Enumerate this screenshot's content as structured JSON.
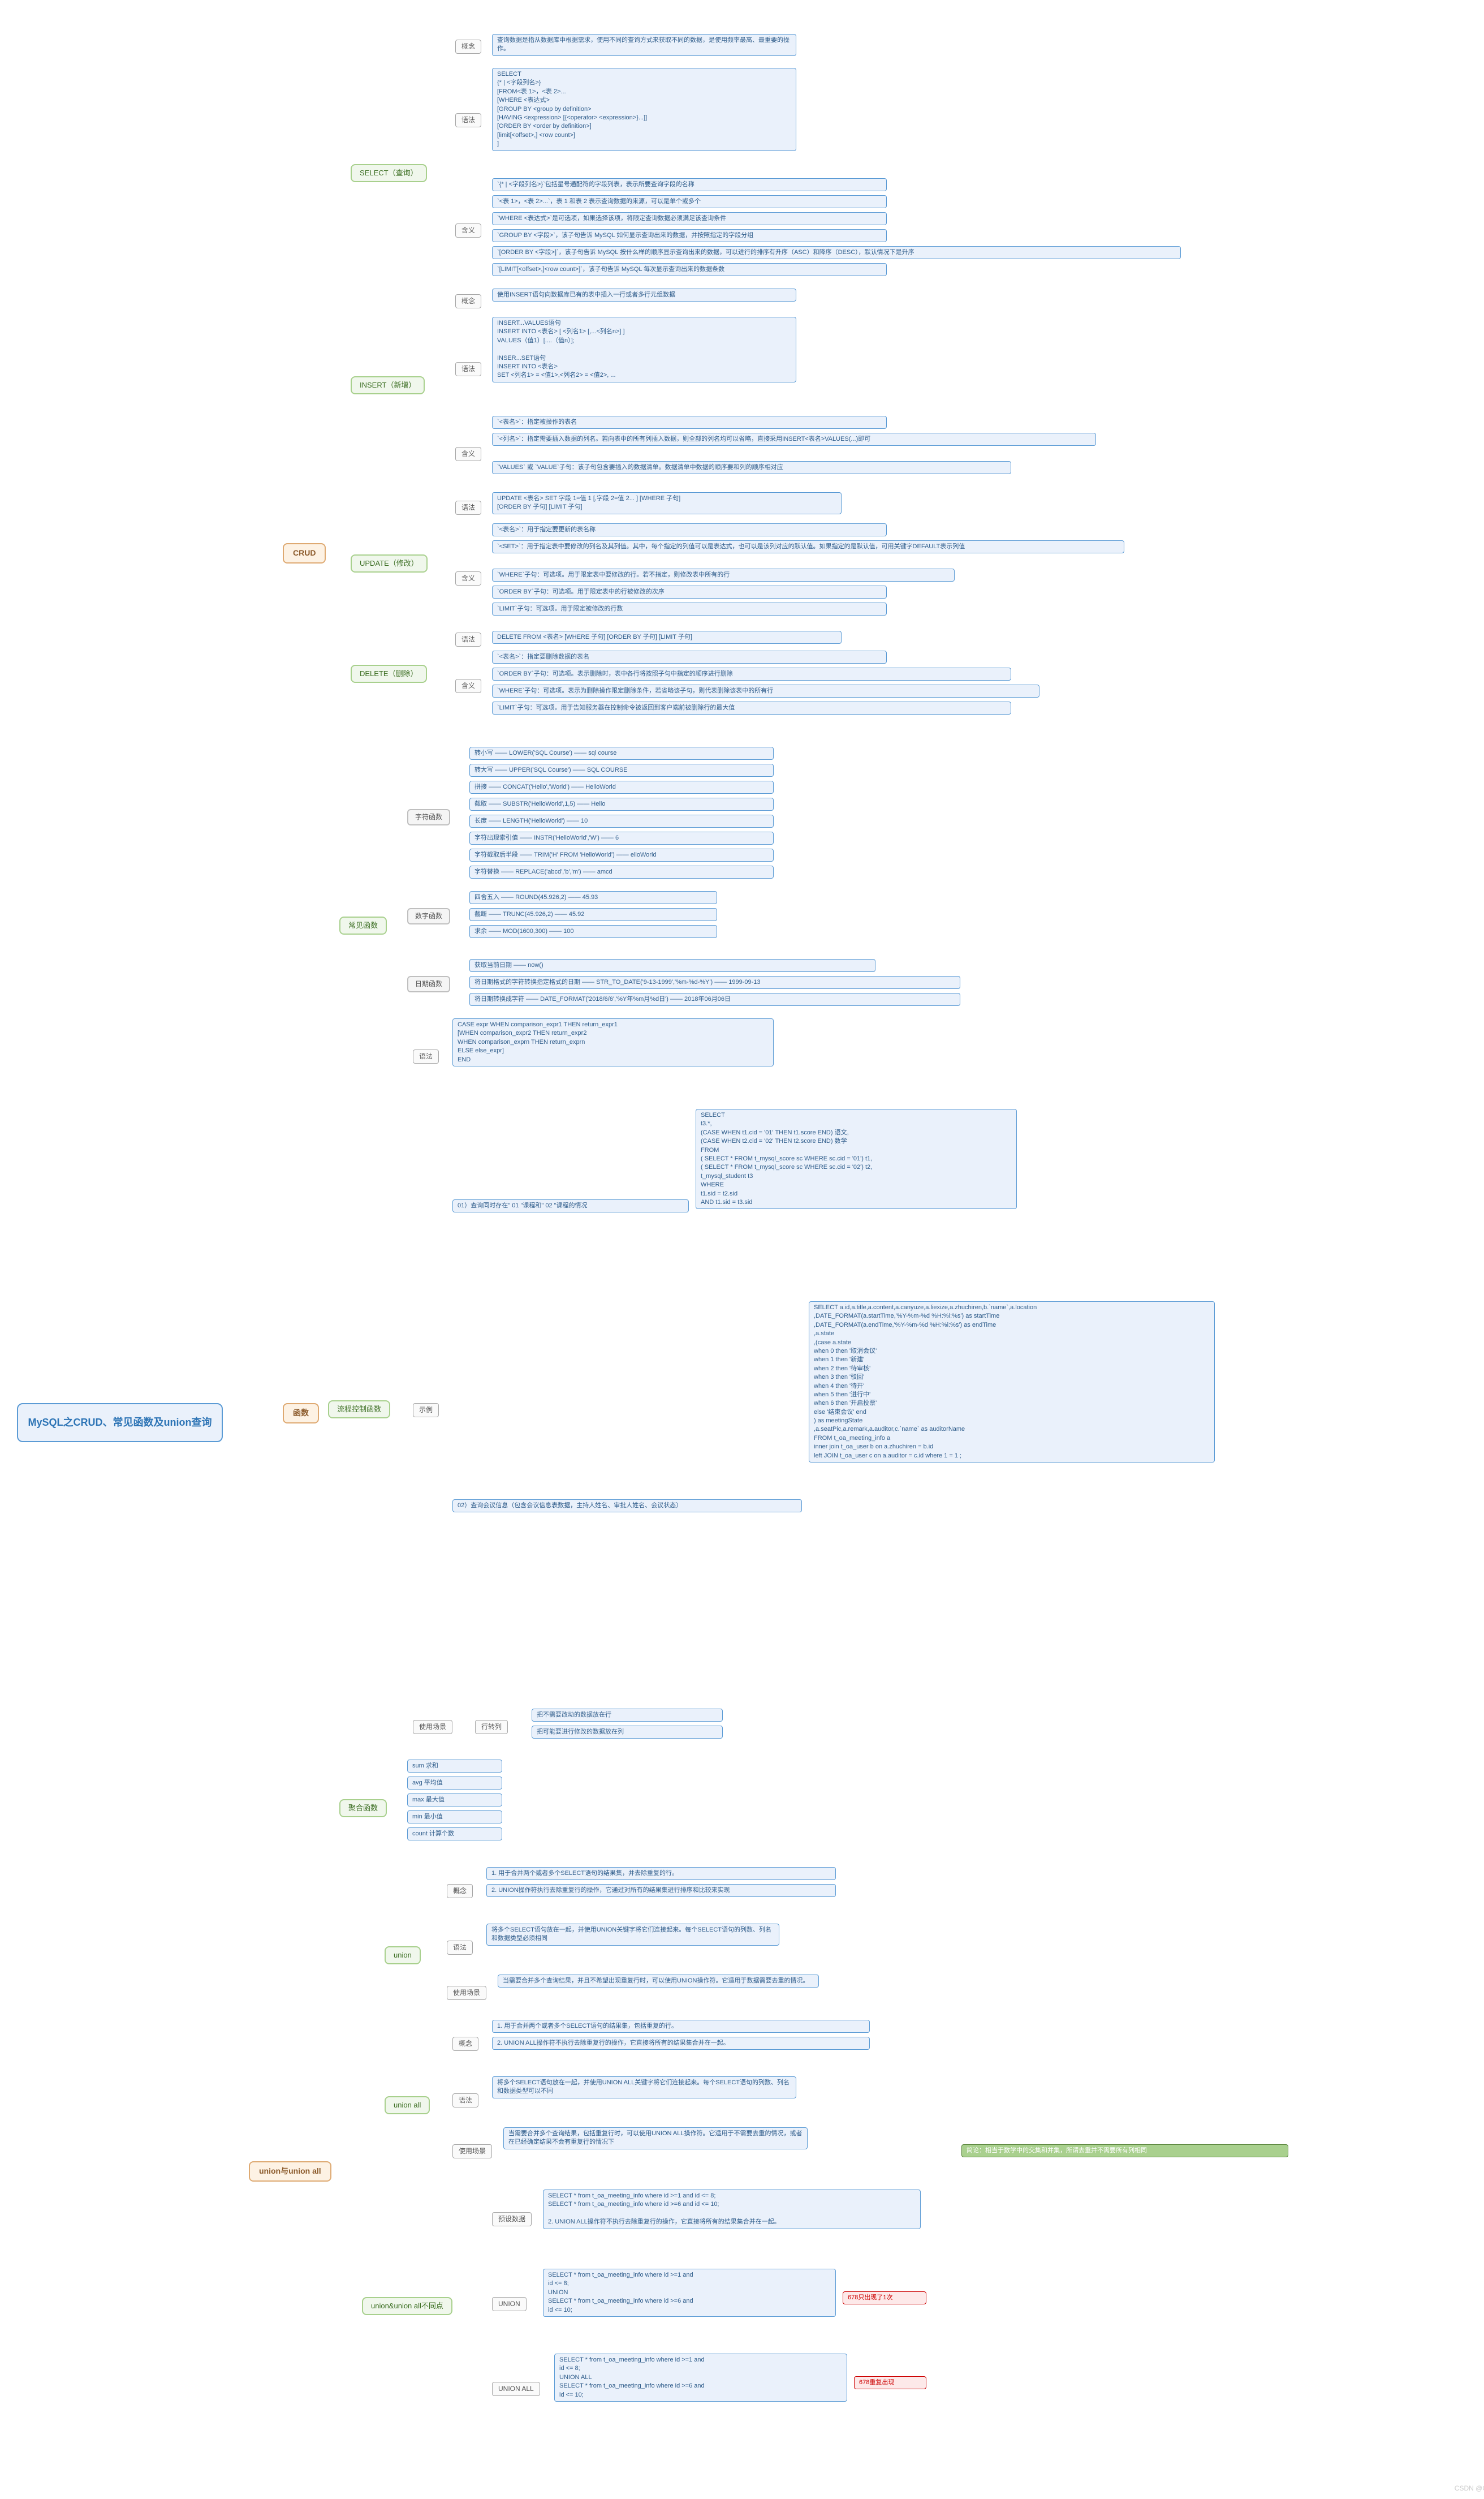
{
  "root": "MySQL之CRUD、常见函数及union查询",
  "crud": {
    "label": "CRUD",
    "select": {
      "label": "SELECT（查询）",
      "gainian": {
        "k": "概念",
        "v": "查询数据是指从数据库中根据需求，使用不同的查询方式来获取不同的数据，是使用频率最高、最重要的操作。"
      },
      "yufa": {
        "k": "语法",
        "v": "SELECT\n{* | <字段列名>}\n[FROM<表 1>，<表 2>...\n[WHERE <表达式>\n[GROUP BY <group by definition>\n[HAVING <expression> [{<operator> <expression>}...]]\n[ORDER BY <order by definition>]\n[limit[<offset>,] <row count>]\n]"
      },
      "hanyi": {
        "k": "含义",
        "items": [
          "`{* | <字段列名>}`包括星号通配符的字段列表，表示所要查询字段的名称",
          "`<表 1>，<表 2>...`，表 1 和表 2 表示查询数据的来源，可以是单个或多个",
          "`WHERE <表达式>`是可选项，如果选择该项，将限定查询数据必须满足该查询条件",
          "`GROUP BY <字段>`，该子句告诉 MySQL 如何显示查询出来的数据，并按照指定的字段分组",
          "`[ORDER BY <字段>]`，该子句告诉 MySQL 按什么样的顺序显示查询出来的数据，可以进行的排序有升序（ASC）和降序（DESC），默认情况下是升序",
          "`[LIMIT[<offset>,]<row count>]`，该子句告诉 MySQL 每次显示查询出来的数据条数"
        ]
      }
    },
    "insert": {
      "label": "INSERT（新增）",
      "gainian": {
        "k": "概念",
        "v": "使用INSERT语句向数据库已有的表中插入一行或者多行元组数据"
      },
      "yufa": {
        "k": "语法",
        "v": "INSERT...VALUES语句\nINSERT INTO <表名> [ <列名1> [,...<列名n>] ]\nVALUES（值1）[....（值n）];\n\nINSER...SET语句\nINSERT INTO <表名>\nSET <列名1> = <值1>,<列名2> = <值2>, ..."
      },
      "hanyi": {
        "k": "含义",
        "items": [
          "`<表名>`：指定被操作的表名",
          "`<列名>`：指定需要插入数据的列名。若向表中的所有列插入数据，则全部的列名均可以省略，直接采用INSERT<表名>VALUES(...)即可",
          "`VALUES` 或 `VALUE`子句：该子句包含要插入的数据清单。数据清单中数据的顺序要和列的顺序相对应"
        ]
      }
    },
    "update": {
      "label": "UPDATE（修改）",
      "yufa": {
        "k": "语法",
        "v": "UPDATE <表名> SET 字段 1=值 1 [,字段 2=值 2... ] [WHERE 子句]\n[ORDER BY 子句] [LIMIT 子句]"
      },
      "hanyi": {
        "k": "含义",
        "items": [
          "`<表名>`：用于指定要更新的表名称",
          "`<SET>`：用于指定表中要修改的列名及其列值。其中，每个指定的列值可以是表达式，也可以是该列对应的默认值。如果指定的是默认值，可用关键字DEFAULT表示列值",
          "`WHERE`子句：可选项。用于限定表中要修改的行。若不指定，则修改表中所有的行",
          "`ORDER BY`子句：可选项。用于限定表中的行被修改的次序",
          "`LIMIT`子句：可选项。用于限定被修改的行数"
        ]
      }
    },
    "delete": {
      "label": "DELETE（删除）",
      "yufa": {
        "k": "语法",
        "v": "DELETE FROM <表名> [WHERE 子句] [ORDER BY 子句] [LIMIT 子句]"
      },
      "hanyi": {
        "k": "含义",
        "items": [
          "`<表名>`：指定要删除数据的表名",
          "`ORDER BY`子句：可选项。表示删除时，表中各行将按照子句中指定的顺序进行删除",
          "`WHERE`子句：可选项。表示为删除操作限定删除条件，若省略该子句，则代表删除该表中的所有行",
          "`LIMIT`子句：可选项。用于告知服务器在控制命令被返回到客户端前被删除行的最大值"
        ]
      }
    }
  },
  "hanshu": {
    "label": "函数",
    "changjian": {
      "label": "常见函数",
      "zifu": {
        "label": "字符函数",
        "items": [
          "转小写 —— LOWER('SQL Course') —— sql course",
          "转大写 —— UPPER('SQL Course') —— SQL COURSE",
          "拼接 —— CONCAT('Hello','World') —— HelloWorld",
          "截取 —— SUBSTR('HelloWorld',1,5) —— Hello",
          "长度 —— LENGTH('HelloWorld') —— 10",
          "字符出现索引值 —— INSTR('HelloWorld','W') —— 6",
          "字符截取后半段 —— TRIM('H' FROM 'HelloWorld') —— elloWorld",
          "字符替换 —— REPLACE('abcd','b','m') —— amcd"
        ]
      },
      "shuzi": {
        "label": "数字函数",
        "items": [
          "四舍五入 —— ROUND(45.926,2) —— 45.93",
          "截断 —— TRUNC(45.926,2) —— 45.92",
          "求余 —— MOD(1600,300) —— 100"
        ]
      },
      "riqi": {
        "label": "日期函数",
        "items": [
          "获取当前日期 —— now()",
          "将日期格式的字符转换指定格式的日期 —— STR_TO_DATE('9-13-1999','%m-%d-%Y') —— 1999-09-13",
          "将日期转换成字符 —— DATE_FORMAT('2018/6/6','%Y年%m月%d日') —— 2018年06月06日"
        ]
      }
    },
    "liucheng": {
      "label": "流程控制函数",
      "yufa": {
        "k": "语法",
        "v": "CASE expr WHEN comparison_expr1 THEN return_expr1\n[WHEN comparison_expr2 THEN return_expr2\nWHEN comparison_exprn THEN return_exprn\nELSE else_expr]\nEND"
      },
      "shili": {
        "k": "示例",
        "s1": {
          "label": "01）查询同时存在\" 01 \"课程和\" 02 \"课程的情况",
          "v": "SELECT\nt3.*,\n(CASE WHEN t1.cid = '01' THEN t1.score END) 语文,\n(CASE WHEN t2.cid = '02' THEN t2.score END) 数学\nFROM\n( SELECT * FROM t_mysql_score sc WHERE sc.cid = '01') t1,\n( SELECT * FROM t_mysql_score sc WHERE sc.cid = '02') t2,\nt_mysql_student t3\nWHERE\nt1.sid = t2.sid\nAND t1.sid = t3.sid"
        },
        "s2": {
          "label": "02）查询会议信息（包含会议信息表数据，主持人姓名、审批人姓名、会议状态）",
          "v": "SELECT a.id,a.title,a.content,a.canyuze,a.liexize,a.zhuchiren,b.`name`,a.location\n,DATE_FORMAT(a.startTime,'%Y-%m-%d %H:%i:%s') as startTime\n,DATE_FORMAT(a.endTime,'%Y-%m-%d %H:%i:%s') as endTime\n,a.state\n,(case a.state\nwhen 0 then '取消会议'\nwhen 1 then '新建'\nwhen 2 then '待审核'\nwhen 3 then '驳回'\nwhen 4 then '待开'\nwhen 5 then '进行中'\nwhen 6 then '开启投票'\nelse '结束会议' end\n) as meetingState\n,a.seatPic,a.remark,a.auditor,c.`name` as auditorName\nFROM t_oa_meeting_info a\ninner join t_oa_user b on a.zhuchiren = b.id\nleft JOIN t_oa_user c on a.auditor = c.id where 1 = 1 ;"
        }
      },
      "shiyong": {
        "k": "使用场景",
        "sub": "行转列",
        "items": [
          "把不需要改动的数据放在行",
          "把可能要进行修改的数据放在列"
        ]
      }
    },
    "juhe": {
      "label": "聚合函数",
      "items": [
        "sum 求和",
        "avg 平均值",
        "max 最大值",
        "min 最小值",
        "count 计算个数"
      ]
    }
  },
  "union": {
    "label": "union与union all",
    "u": {
      "label": "union",
      "gainian": {
        "k": "概念",
        "items": [
          "1. 用于合并两个或者多个SELECT语句的结果集，并去除重复的行。",
          "2. UNION操作符执行去除重复行的操作，它通过对所有的结果集进行排序和比较来实现"
        ]
      },
      "yufa": {
        "k": "语法",
        "v": "将多个SELECT语句放在一起，并使用UNION关键字将它们连接起来。每个SELECT语句的列数、列名和数据类型必须相同"
      },
      "shiyong": {
        "k": "使用场景",
        "v": "当需要合并多个查询结果，并且不希望出现重复行时，可以使用UNION操作符。它适用于数据需要去重的情况。"
      }
    },
    "ua": {
      "label": "union all",
      "gainian": {
        "k": "概念",
        "items": [
          "1. 用于合并两个或者多个SELECT语句的结果集，包括重复的行。",
          "2. UNION ALL操作符不执行去除重复行的操作，它直接将所有的结果集合并在一起。"
        ]
      },
      "yufa": {
        "k": "语法",
        "v": "将多个SELECT语句放在一起，并使用UNION ALL关键字将它们连接起来。每个SELECT语句的列数、列名和数据类型可以不同"
      },
      "shiyong": {
        "k": "使用场景",
        "v": "当需要合并多个查询结果，包括重复行时，可以使用UNION ALL操作符。它适用于不需要去重的情况，或者在已经确定结果不会有重复行的情况下"
      }
    },
    "diff": {
      "label": "union&union all不同点",
      "moni": {
        "k": "预设数据",
        "v": "SELECT * from t_oa_meeting_info where id >=1 and id <= 8;\nSELECT * from t_oa_meeting_info where id >=6 and id <= 10;\n\n2. UNION ALL操作符不执行去除重复行的操作，它直接将所有的结果集合并在一起。"
      },
      "un": {
        "k": "UNION",
        "v": "SELECT * from t_oa_meeting_info where id >=1 and\nid <= 8;\nUNION\nSELECT * from t_oa_meeting_info where id >=6 and\nid <= 10;",
        "note": "678只出现了1次"
      },
      "ual": {
        "k": "UNION ALL",
        "v": "SELECT * from t_oa_meeting_info where id >=1 and\nid <= 8;\nUNION ALL\nSELECT * from t_oa_meeting_info where id >=6 and\nid <= 10;",
        "note": "678重复出现"
      }
    },
    "jianlun": "简论：相当于数学中的交集和并集，所谓去重并不需要所有列相同"
  },
  "watermark": "CSDN @Gun"
}
